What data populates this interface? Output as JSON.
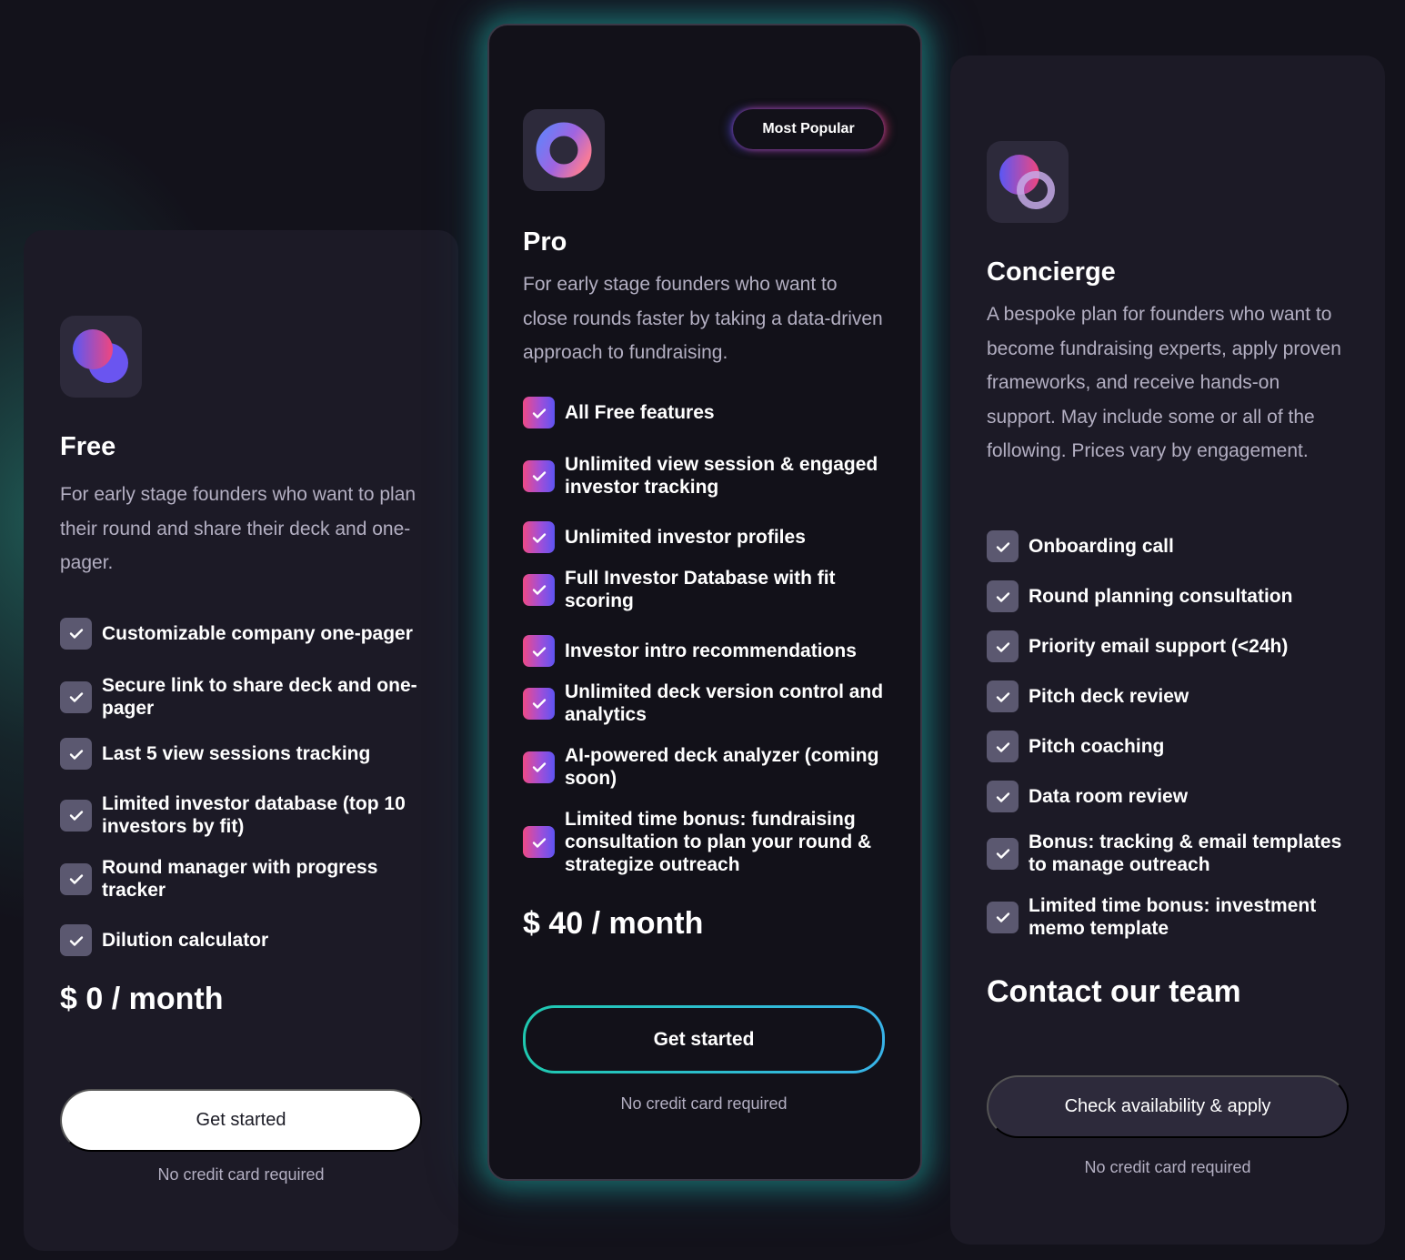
{
  "plans": [
    {
      "id": "free",
      "icon": "two-overlapping-circles-logo",
      "title": "Free",
      "description": "For early stage founders who want to plan their round and share their deck and one-pager.",
      "features": [
        "Customizable company one-pager",
        "Secure link to share deck and one-pager",
        "Last 5 view sessions tracking",
        "Limited investor database (top 10 investors by fit)",
        "Round manager with progress tracker",
        "Dilution calculator"
      ],
      "price": "$ 0 / month",
      "cta_label": "Get started",
      "note": "No credit card required"
    },
    {
      "id": "pro",
      "icon": "ring-logo",
      "badge": "Most Popular",
      "title": "Pro",
      "description": "For early stage founders who want to close rounds faster by taking a data-driven approach to fundraising.",
      "features": [
        "All Free features",
        "Unlimited view session & engaged investor tracking",
        "Unlimited investor profiles",
        "Full Investor Database with fit scoring",
        "Investor intro recommendations",
        "Unlimited deck version control and analytics",
        "AI-powered deck analyzer (coming soon)",
        "Limited time bonus: fundraising consultation to plan your round & strategize outreach"
      ],
      "price": "$ 40 / month",
      "cta_label": "Get started",
      "note": "No credit card required"
    },
    {
      "id": "concierge",
      "icon": "circle-and-ring-logo",
      "title": "Concierge",
      "description": "A bespoke plan for founders who want to become fundraising experts, apply proven frameworks, and receive hands-on support. May include some or all of the following. Prices vary by engagement.",
      "features": [
        "Onboarding call",
        "Round planning consultation",
        "Priority email support (<24h)",
        "Pitch deck review",
        "Pitch coaching",
        "Data room review",
        "Bonus: tracking & email templates to manage outreach",
        "Limited time bonus: investment memo template"
      ],
      "price": "Contact our team",
      "cta_label": "Check availability & apply",
      "note": "No credit card required"
    }
  ],
  "colors": {
    "background": "#13121b",
    "card": "#1c1a26",
    "pro_card": "#121119",
    "pro_glow": "#1fa096",
    "check_default": "#5b5870",
    "check_pro_start": "#ef4a86",
    "check_pro_end": "#5d54f3",
    "muted_text": "#b3afc2"
  }
}
